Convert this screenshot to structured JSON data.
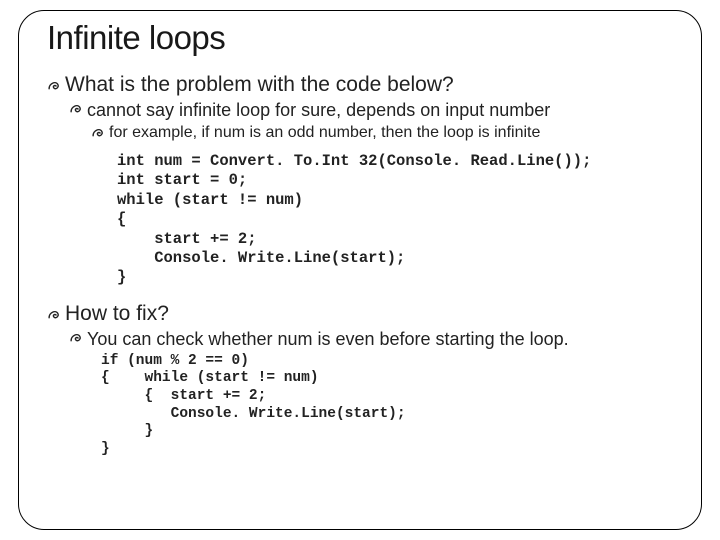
{
  "title": "Infinite loops",
  "b1": "What is the problem with the code below?",
  "b1_1": "cannot say infinite loop for sure, depends on input number",
  "b1_1_1": "for example, if num is an odd number, then the loop is infinite",
  "code1": "int num = Convert. To.Int 32(Console. Read.Line());\nint start = 0;\nwhile (start != num)\n{\n    start += 2;\n    Console. Write.Line(start);\n}",
  "b2": "How to fix?",
  "b2_1": "You can check whether num is even before starting the loop.",
  "code2": "if (num % 2 == 0)\n{    while (start != num)\n     {  start += 2;\n        Console. Write.Line(start);\n     }\n}"
}
